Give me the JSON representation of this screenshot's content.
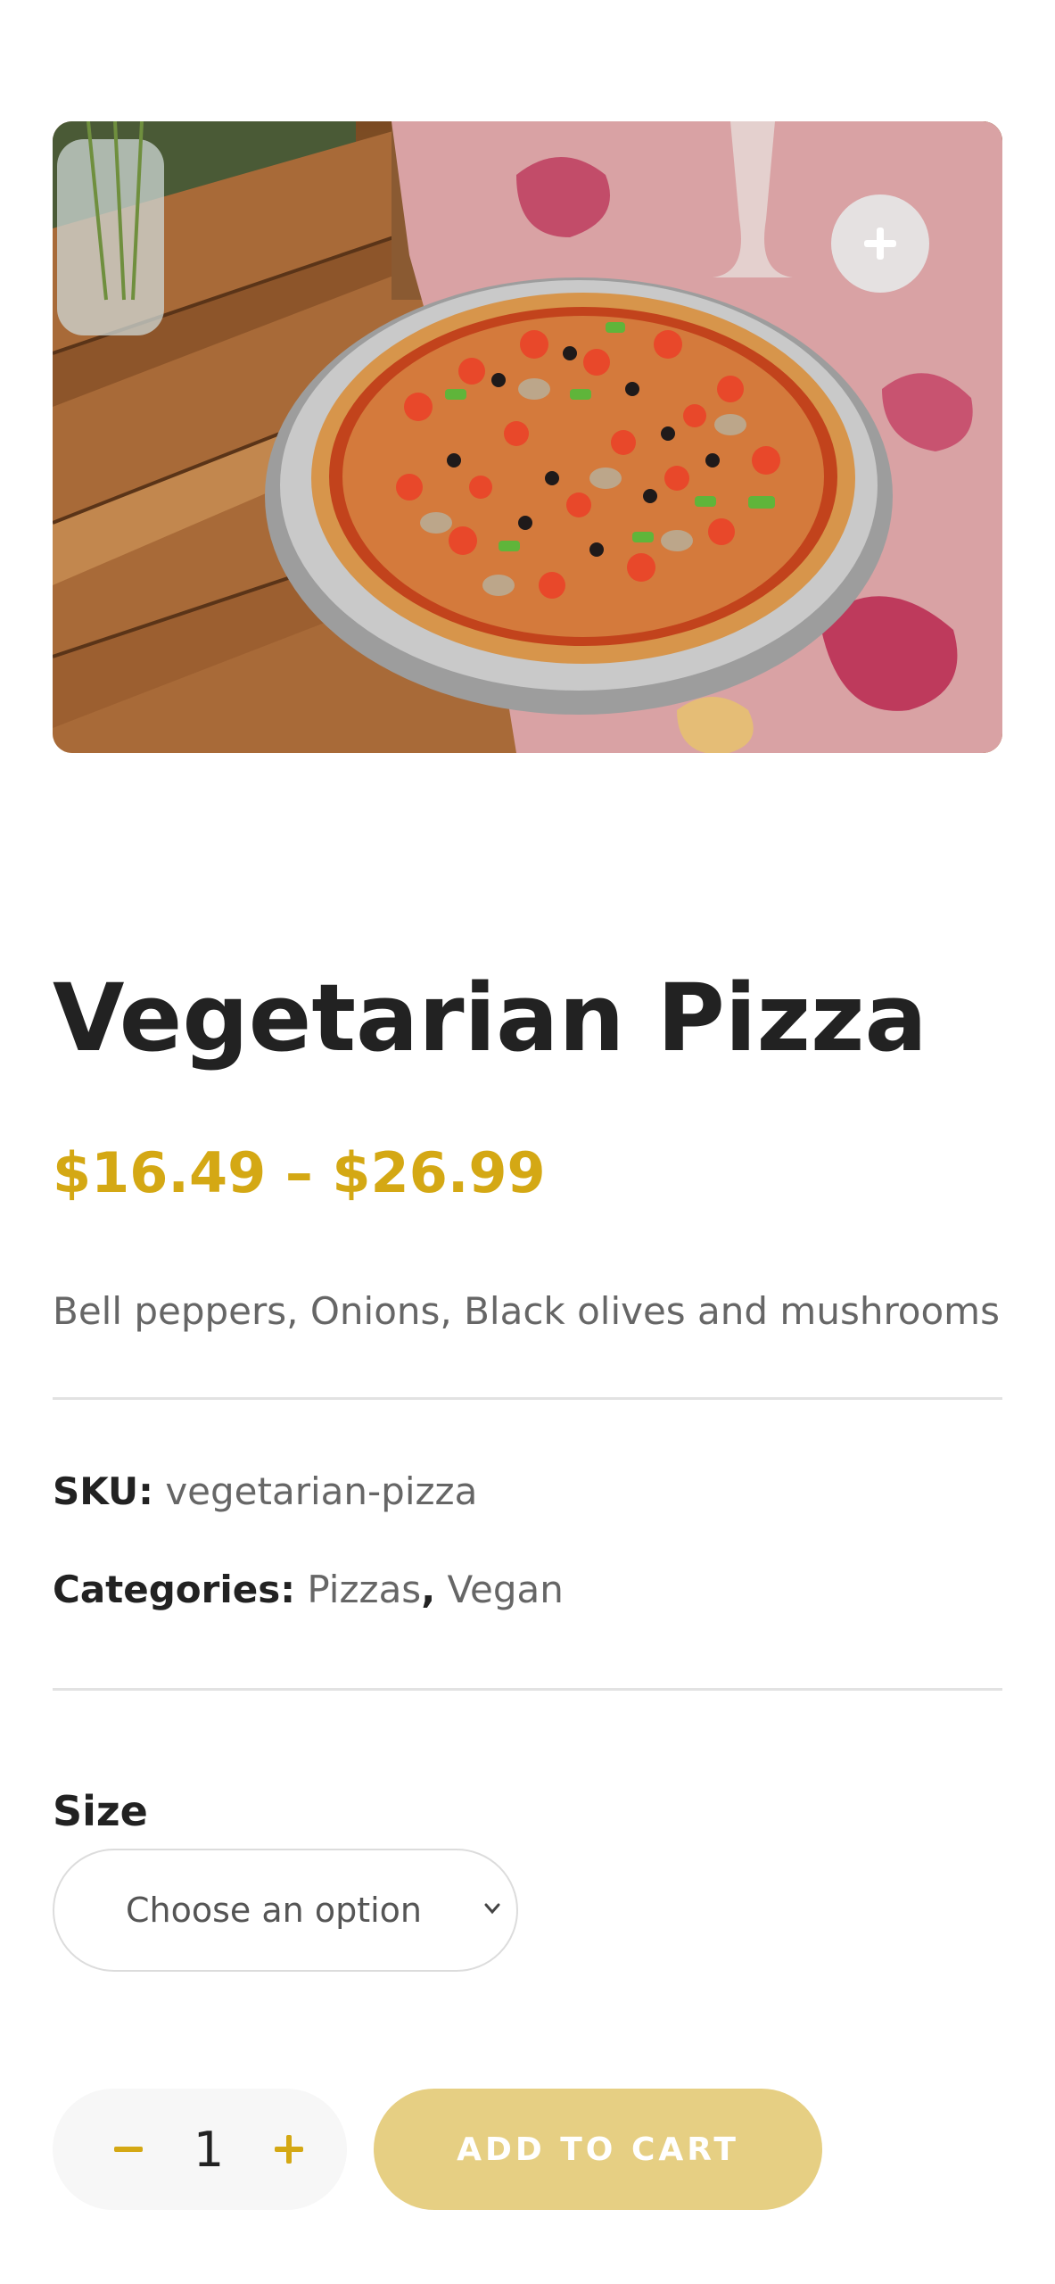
{
  "product": {
    "title": "Vegetarian Pizza",
    "price_range": "$16.49 – $26.99",
    "description": "Bell peppers, Onions, Black olives and mushrooms"
  },
  "meta": {
    "sku_label": "SKU:",
    "sku_value": "vegetarian-pizza",
    "categories_label": "Categories:",
    "categories": [
      "Pizzas",
      "Vegan"
    ],
    "separator": ","
  },
  "variation": {
    "size_label": "Size",
    "select_value": "Choose an option"
  },
  "cart": {
    "quantity": "1",
    "add_to_cart_label": "ADD TO CART"
  },
  "colors": {
    "accent": "#d4a814",
    "button": "#e6cf83",
    "text": "#222222",
    "muted": "#666666"
  },
  "icons": {
    "zoom": "plus-icon",
    "minus": "minus-icon",
    "plus": "plus-icon",
    "chevron": "chevron-down-icon"
  }
}
